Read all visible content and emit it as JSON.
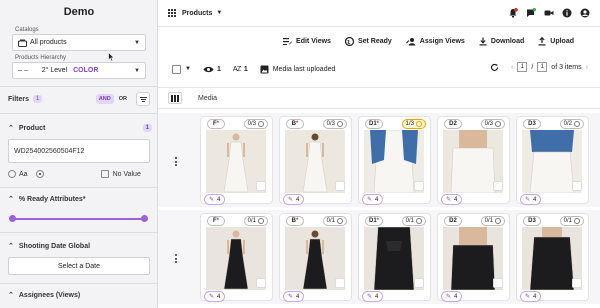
{
  "app": {
    "title": "Demo"
  },
  "sidebar": {
    "catalogs_label": "Catalogs",
    "catalogs_value": "All products",
    "hierarchy_label": "Products Hierarchy",
    "hierarchy_dash": "– –",
    "hierarchy_level": "2° Level",
    "hierarchy_color": "COLOR",
    "filters_label": "Filters",
    "filters_count": "1",
    "and_label": "AND",
    "or_label": "OR",
    "product_label": "Product",
    "product_count": "1",
    "product_value": "WD254002560504F12",
    "aa_label": "Aa",
    "no_value_label": "No Value",
    "ready_attr_label": "% Ready Attributes*",
    "ready_range": [
      0,
      100
    ],
    "shooting_label": "Shooting Date Global",
    "select_date_label": "Select a Date",
    "assignees_label": "Assignees (Views)"
  },
  "topbar": {
    "title": "Products",
    "notification_color": "#e0281f",
    "chat_badge_color": "#2ab04a"
  },
  "actions": {
    "edit_views": "Edit Views",
    "set_ready": "Set Ready",
    "assign_views": "Assign Views",
    "download": "Download",
    "upload": "Upload"
  },
  "toolbar": {
    "visible_count": "1",
    "sort_count": "1",
    "sort_label": "AZ",
    "media_last": "Media last uploaded",
    "page_current": "1",
    "page_sep": "/",
    "page_box": "1",
    "page_total": "of 3 items"
  },
  "grid": {
    "media_header": "Media"
  },
  "rows": [
    {
      "cards": [
        {
          "code": "F",
          "star": "*",
          "count": "0/3",
          "warn": false,
          "likes": "4",
          "tone": "light",
          "pose": "front"
        },
        {
          "code": "B",
          "star": "*",
          "count": "0/3",
          "warn": false,
          "likes": "4",
          "tone": "light",
          "pose": "back"
        },
        {
          "code": "D1",
          "star": "*",
          "count": "1/3",
          "warn": true,
          "likes": "4",
          "tone": "denim",
          "pose": "detail"
        },
        {
          "code": "D2",
          "star": "",
          "count": "0/3",
          "warn": false,
          "likes": "4",
          "tone": "light",
          "pose": "close"
        },
        {
          "code": "D3",
          "star": "",
          "count": "0/2",
          "warn": false,
          "likes": "4",
          "tone": "denim",
          "pose": "close2"
        }
      ]
    },
    {
      "cards": [
        {
          "code": "F",
          "star": "*",
          "count": "0/1",
          "warn": false,
          "likes": "4",
          "tone": "dark",
          "pose": "front"
        },
        {
          "code": "B",
          "star": "*",
          "count": "0/1",
          "warn": false,
          "likes": "4",
          "tone": "dark",
          "pose": "back"
        },
        {
          "code": "D1",
          "star": "*",
          "count": "0/1",
          "warn": false,
          "likes": "4",
          "tone": "dark",
          "pose": "detail"
        },
        {
          "code": "D2",
          "star": "",
          "count": "0/1",
          "warn": false,
          "likes": "4",
          "tone": "dark",
          "pose": "close"
        },
        {
          "code": "D3",
          "star": "",
          "count": "0/1",
          "warn": false,
          "likes": "4",
          "tone": "dark",
          "pose": "close2"
        }
      ]
    }
  ]
}
